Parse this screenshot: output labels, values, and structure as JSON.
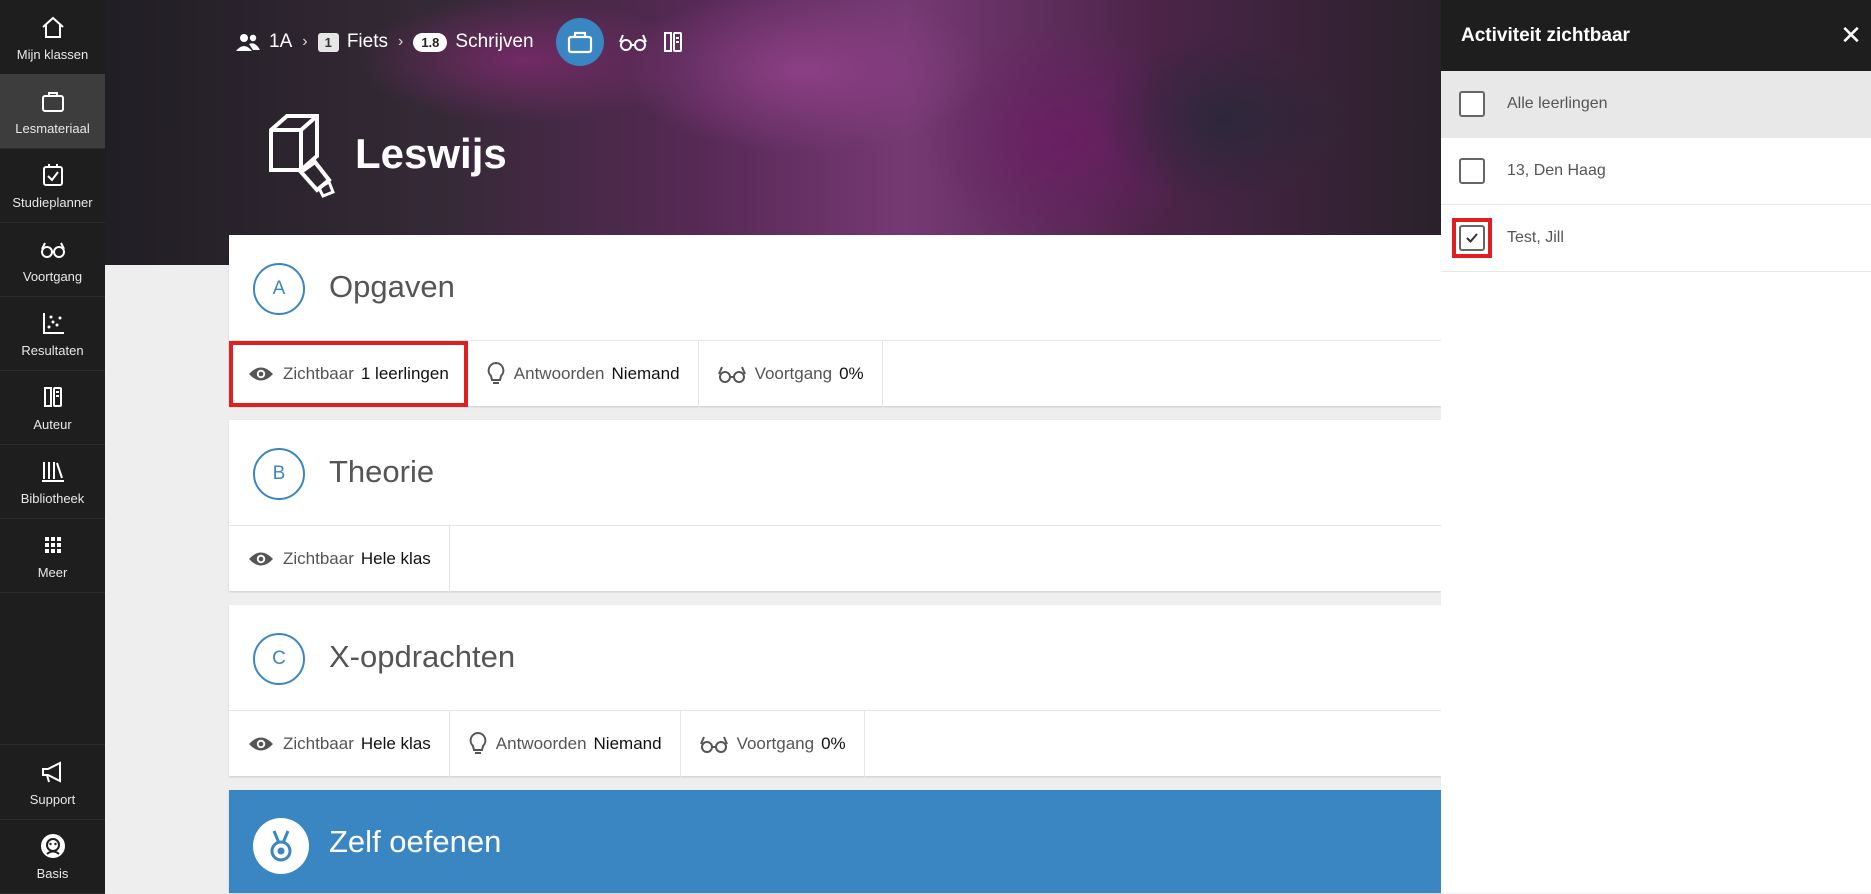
{
  "sidebar": {
    "items": [
      {
        "label": "Mijn klassen",
        "icon": "home-icon"
      },
      {
        "label": "Lesmateriaal",
        "icon": "briefcase-icon"
      },
      {
        "label": "Studieplanner",
        "icon": "calendar-check-icon"
      },
      {
        "label": "Voortgang",
        "icon": "glasses-icon"
      },
      {
        "label": "Resultaten",
        "icon": "scatter-chart-icon"
      },
      {
        "label": "Auteur",
        "icon": "author-icon"
      },
      {
        "label": "Bibliotheek",
        "icon": "library-icon"
      },
      {
        "label": "Meer",
        "icon": "grid-icon"
      },
      {
        "label": "Support",
        "icon": "megaphone-icon"
      },
      {
        "label": "Basis",
        "icon": "avatar-icon"
      }
    ],
    "active": "Lesmateriaal"
  },
  "breadcrumb": {
    "class": "1A",
    "chapter_number": "1",
    "chapter": "Fiets",
    "section_number": "1.8",
    "section": "Schrijven"
  },
  "header": {
    "title": "Leswijs"
  },
  "cards": [
    {
      "letter": "A",
      "title": "Opgaven",
      "visible_label": "Zichtbaar",
      "visible_value": "1 leerlingen",
      "answers_label": "Antwoorden",
      "answers_value": "Niemand",
      "progress_label": "Voortgang",
      "progress_value": "0%"
    },
    {
      "letter": "B",
      "title": "Theorie",
      "visible_label": "Zichtbaar",
      "visible_value": "Hele klas"
    },
    {
      "letter": "C",
      "title": "X-opdrachten",
      "visible_label": "Zichtbaar",
      "visible_value": "Hele klas",
      "answers_label": "Antwoorden",
      "answers_value": "Niemand",
      "progress_label": "Voortgang",
      "progress_value": "0%"
    },
    {
      "title": "Zelf oefenen"
    }
  ],
  "panel": {
    "title": "Activiteit zichtbaar",
    "close_icon": "close-icon",
    "options": [
      {
        "label": "Alle leerlingen",
        "checked": false
      },
      {
        "label": "13, Den Haag",
        "checked": false
      },
      {
        "label": "Test, Jill",
        "checked": true
      }
    ]
  },
  "colors": {
    "accent": "#3a86c3",
    "highlight": "#e02020",
    "sidebar": "#1e1e1e"
  }
}
